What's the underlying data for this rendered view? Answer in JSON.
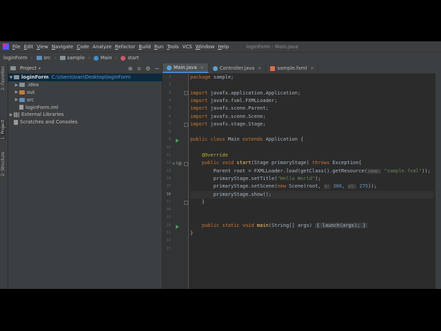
{
  "window_title": "loginForm - Main.java",
  "menu": [
    {
      "key": "F",
      "rest": "ile"
    },
    {
      "key": "E",
      "rest": "dit"
    },
    {
      "key": "V",
      "rest": "iew"
    },
    {
      "key": "N",
      "rest": "avigate"
    },
    {
      "key": "C",
      "rest": "ode"
    },
    {
      "key": "",
      "rest": "Analyze"
    },
    {
      "key": "R",
      "rest": "efactor"
    },
    {
      "key": "B",
      "rest": "uild"
    },
    {
      "key": "R",
      "rest": "un"
    },
    {
      "key": "T",
      "rest": "ools"
    },
    {
      "key": "",
      "rest": "VCS"
    },
    {
      "key": "W",
      "rest": "indow"
    },
    {
      "key": "H",
      "rest": "elp"
    }
  ],
  "breadcrumbs": [
    "loginForm",
    "src",
    "sample",
    "Main",
    "start"
  ],
  "side_tabs": [
    "1: Project",
    "2: Favorites",
    "2: Structure"
  ],
  "project_panel": {
    "title": "Project",
    "tree": [
      {
        "name": "loginForm",
        "path": "C:\\Users\\Ivan\\Desktop\\loginForm"
      },
      {
        "name": ".idea"
      },
      {
        "name": "out"
      },
      {
        "name": "src"
      },
      {
        "name": "loginForm.iml"
      },
      {
        "name": "External Libraries"
      },
      {
        "name": "Scratches and Consoles"
      }
    ]
  },
  "tabs": [
    {
      "label": "Main.java",
      "color": "#5c9fd6"
    },
    {
      "label": "Controller.java",
      "color": "#5c9fd6"
    },
    {
      "label": "sample.fxml",
      "color": "#e06c4a"
    }
  ],
  "code": {
    "l1_kw": "package",
    "l1_rest": " sample;",
    "l3_kw": "import",
    "l3_rest": " javafx.application.Application;",
    "l4_kw": "import",
    "l4_rest": " javafx.fxml.FXMLLoader;",
    "l5_kw": "import",
    "l5_rest": " javafx.scene.Parent;",
    "l6_kw": "import",
    "l6_rest": " javafx.scene.Scene;",
    "l7_kw": "import",
    "l7_rest": " javafx.stage.Stage;",
    "l9_kw": "public class",
    "l9_a": " Main ",
    "l9_kw2": "extends",
    "l9_b": " Application {",
    "l11_ann": "@Override",
    "l12_kw": "public void",
    "l12_fn": " start",
    "l12_a": "(Stage primaryStage) ",
    "l12_kw2": "throws",
    "l12_b": " Exception{",
    "l13_a": "Parent root = FXMLLoader.",
    "l13_it": "load",
    "l13_b": "(getClass().getResource(",
    "l13_hint": "name:",
    "l13_str": " \"sample.fxml\"",
    "l13_c": "));",
    "l14_a": "primaryStage.setTitle(",
    "l14_str": "\"Hello World\"",
    "l14_b": ");",
    "l15_a": "primaryStage.setScene(",
    "l15_kw": "new",
    "l15_b": " Scene(root, ",
    "l15_h1": "v:",
    "l15_n1": " 300",
    "l15_c": ", ",
    "l15_h2": "v1:",
    "l15_n2": " 275",
    "l15_d": "));",
    "l16_a": "primaryStage.show();",
    "l17": "}",
    "l20_kw": "public static void",
    "l20_fn": " main",
    "l20_a": "(String[] args) ",
    "l20_fold": "{ launch(args); }",
    "l21": "}"
  },
  "line_numbers": [
    "1",
    "2",
    "3",
    "4",
    "5",
    "6",
    "7",
    "8",
    "9",
    "10",
    "11",
    "12",
    "13",
    "14",
    "15",
    "16",
    "17",
    "18",
    "19",
    "20",
    "21",
    "22",
    "23"
  ]
}
